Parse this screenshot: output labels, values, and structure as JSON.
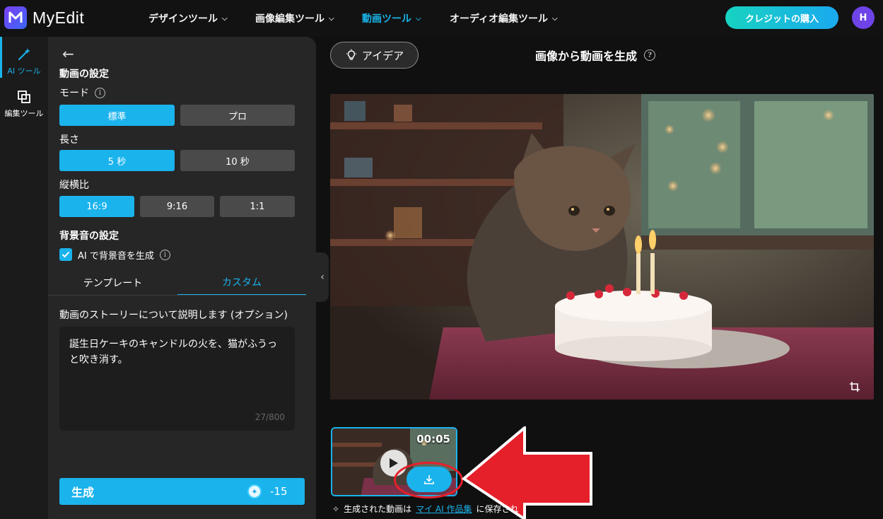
{
  "header": {
    "brand": "MyEdit",
    "nav": [
      {
        "label": "デザインツール",
        "active": false
      },
      {
        "label": "画像編集ツール",
        "active": false
      },
      {
        "label": "動画ツール",
        "active": true
      },
      {
        "label": "オーディオ編集ツール",
        "active": false
      }
    ],
    "buy_credits": "クレジットの購入",
    "avatar_initial": "H"
  },
  "rail": {
    "items": [
      {
        "label": "AI ツール",
        "icon": "magic-wand-icon",
        "active": true
      },
      {
        "label": "編集ツール",
        "icon": "layers-icon",
        "active": false
      }
    ]
  },
  "settings": {
    "video_settings_title": "動画の設定",
    "mode_label": "モード",
    "mode_options": [
      "標準",
      "プロ"
    ],
    "mode_selected": "標準",
    "length_label": "長さ",
    "length_options": [
      "5 秒",
      "10 秒"
    ],
    "length_selected": "5 秒",
    "aspect_label": "縦横比",
    "aspect_options": [
      "16:9",
      "9:16",
      "1:1"
    ],
    "aspect_selected": "16:9",
    "bgm_title": "背景音の設定",
    "bgm_checkbox_label": "AI で背景音を生成",
    "bgm_checked": true,
    "tabs": [
      "テンプレート",
      "カスタム"
    ],
    "active_tab": "カスタム",
    "story_label": "動画のストーリーについて説明します (オプション)",
    "story_text": "誕生日ケーキのキャンドルの火を、猫がふうっと吹き消す。",
    "char_counter": "27/800",
    "generate_label": "生成",
    "generate_cost": "-15"
  },
  "main": {
    "idea_button": "アイデア",
    "title": "画像から動画を生成",
    "preview_alt": "Cat looking at birthday cake with candles",
    "thumbnail_duration": "00:05",
    "saved_note_prefix": "生成された動画は",
    "saved_note_link": "マイ AI 作品集",
    "saved_note_suffix": "に保存され"
  },
  "colors": {
    "accent": "#1ab3ec",
    "annotation_red": "#e5202a"
  }
}
